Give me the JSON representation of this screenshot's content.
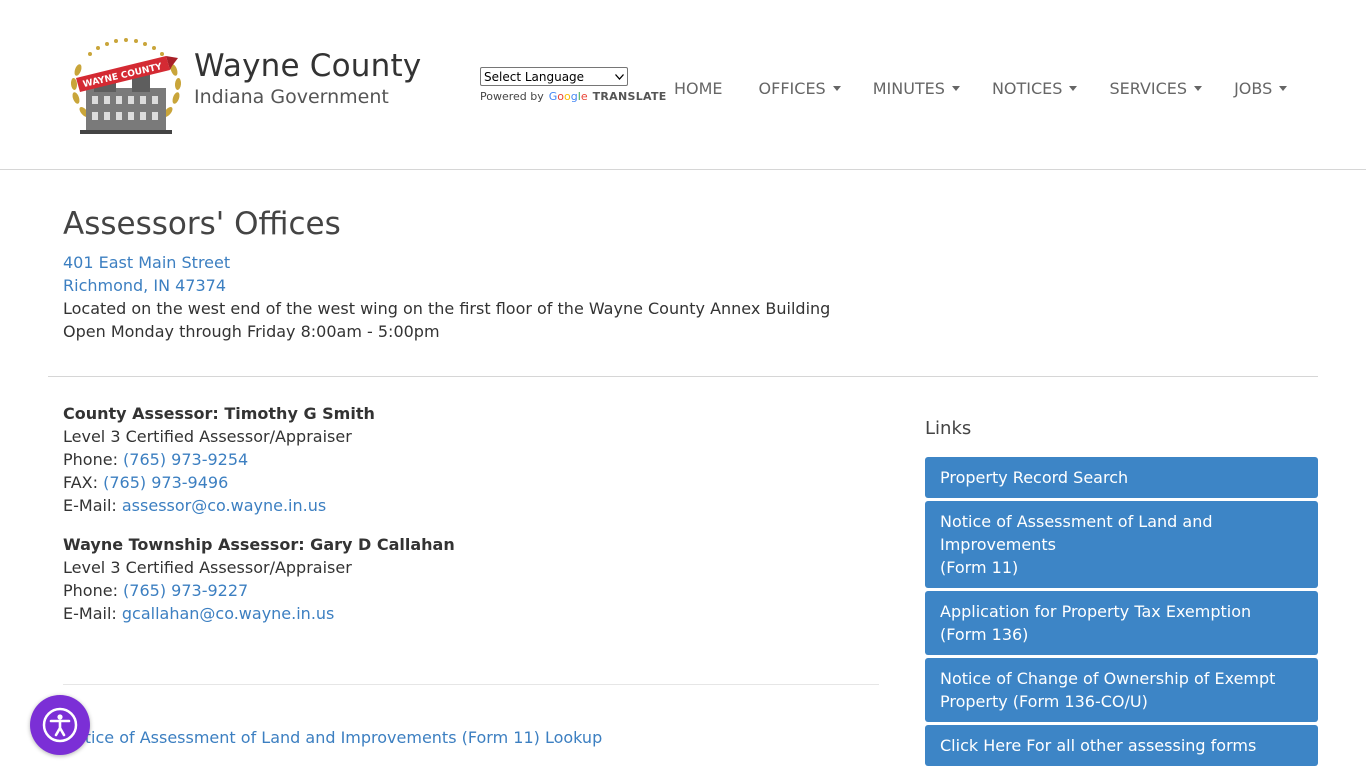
{
  "header": {
    "brand_title": "Wayne County",
    "brand_subtitle": "Indiana Government",
    "logo_text": "WAYNE COUNTY",
    "translate": {
      "select_value": "Select Language",
      "powered_by": "Powered by",
      "google": "Google",
      "translate_word": "TRANSLATE"
    },
    "nav": [
      {
        "label": "HOME",
        "dropdown": false
      },
      {
        "label": "OFFICES",
        "dropdown": true
      },
      {
        "label": "MINUTES",
        "dropdown": true
      },
      {
        "label": "NOTICES",
        "dropdown": true
      },
      {
        "label": "SERVICES",
        "dropdown": true
      },
      {
        "label": "JOBS",
        "dropdown": true
      }
    ]
  },
  "office": {
    "title": "Assessors' Offices",
    "address_line1": "401 East Main Street",
    "address_line2": "Richmond, IN 47374",
    "location_note": "Located on the west end of the west wing on the first floor of the Wayne County Annex Building",
    "hours": "Open Monday through Friday 8:00am - 5:00pm"
  },
  "contacts": [
    {
      "name": "County Assessor: Timothy G Smith",
      "certification": "Level 3 Certified Assessor/Appraiser",
      "phone_label": "Phone:",
      "phone": "(765) 973-9254",
      "fax_label": "FAX:",
      "fax": "(765) 973-9496",
      "email_label": "E-Mail:",
      "email": "assessor@co.wayne.in.us"
    },
    {
      "name": "Wayne Township Assessor: Gary D Callahan",
      "certification": "Level 3 Certified Assessor/Appraiser",
      "phone_label": "Phone:",
      "phone": "(765) 973-9227",
      "email_label": "E-Mail:",
      "email": "gcallahan@co.wayne.in.us"
    }
  ],
  "lookup_link": "Notice of Assessment of Land and Improvements (Form 11) Lookup",
  "sidebar": {
    "title": "Links",
    "links": [
      {
        "lines": [
          "Property Record Search"
        ]
      },
      {
        "lines": [
          "Notice of Assessment of Land and",
          "Improvements",
          "(Form 11)"
        ]
      },
      {
        "lines": [
          "Application for Property Tax Exemption",
          "(Form 136)"
        ]
      },
      {
        "lines": [
          "Notice of Change of Ownership of Exempt",
          "Property (Form 136-CO/U)"
        ]
      },
      {
        "lines": [
          "Click Here For all other assessing forms"
        ]
      }
    ]
  },
  "colors": {
    "link": "#3c7fc1",
    "sidebar_button": "#3d85c6",
    "accessibility_button": "#7b2fd6"
  },
  "icons": {
    "accessibility": "accessibility-icon",
    "nav_dropdown": "caret-down-icon"
  }
}
